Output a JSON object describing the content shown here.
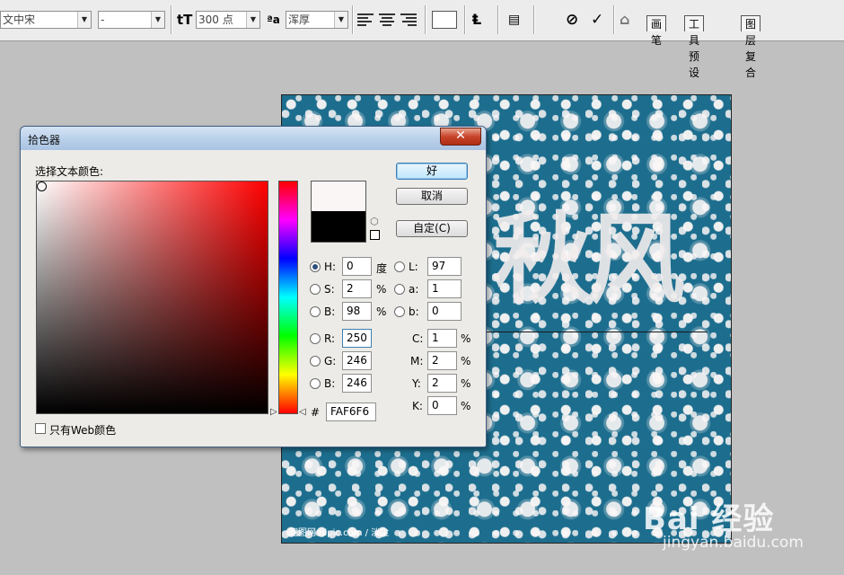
{
  "options_bar": {
    "font_family": "文中宋",
    "font_style": "-",
    "font_size": "300 点",
    "antialias": "浑厚",
    "text_icon": "tT",
    "aa_icon": "ªa",
    "warp_icon": "text-warp-icon",
    "cancel_icon": "⊘",
    "commit_icon": "✓",
    "tabs": [
      "画笔",
      "工具预设",
      "图层复合"
    ]
  },
  "canvas": {
    "big_text": "秋风",
    "credit": "昵图网 nipic.com / 淡尘",
    "pattern_color": "#1d6e8e",
    "flower_color": "#faf6f6"
  },
  "watermark": {
    "text": "Bai 经验",
    "url": "jingyan.baidu.com"
  },
  "dialog": {
    "title": "拾色器",
    "close_label": "✕",
    "prompt": "选择文本颜色:",
    "buttons": {
      "ok": "好",
      "cancel": "取消",
      "custom": "自定(C)"
    },
    "hsb": [
      {
        "label": "H:",
        "value": "0",
        "unit": "度",
        "selected": true
      },
      {
        "label": "S:",
        "value": "2",
        "unit": "%",
        "selected": false
      },
      {
        "label": "B:",
        "value": "98",
        "unit": "%",
        "selected": false
      }
    ],
    "rgb": [
      {
        "label": "R:",
        "value": "250",
        "selected": false
      },
      {
        "label": "G:",
        "value": "246",
        "selected": false
      },
      {
        "label": "B:",
        "value": "246",
        "selected": false
      }
    ],
    "lab": [
      {
        "label": "L:",
        "value": "97"
      },
      {
        "label": "a:",
        "value": "1"
      },
      {
        "label": "b:",
        "value": "0"
      }
    ],
    "cmyk": [
      {
        "label": "C:",
        "value": "1",
        "unit": "%"
      },
      {
        "label": "M:",
        "value": "2",
        "unit": "%"
      },
      {
        "label": "Y:",
        "value": "2",
        "unit": "%"
      },
      {
        "label": "K:",
        "value": "0",
        "unit": "%"
      }
    ],
    "hex_label": "#",
    "hex_value": "FAF6F6",
    "web_only_label": "只有Web颜色",
    "web_only_checked": false,
    "new_color": "#faf6f6",
    "old_color": "#000000"
  }
}
